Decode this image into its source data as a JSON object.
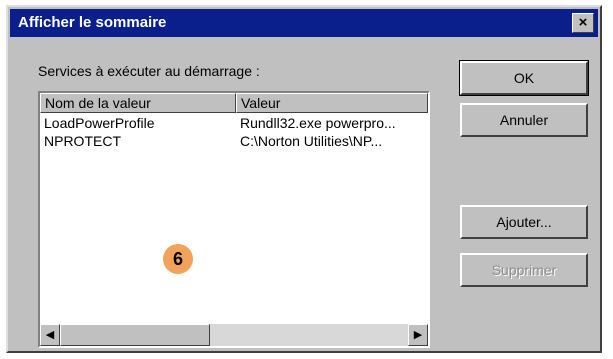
{
  "window": {
    "title": "Afficher le sommaire",
    "close_glyph": "×"
  },
  "label": "Services à exécuter au démarrage :",
  "list": {
    "columns": [
      "Nom de la valeur",
      "Valeur"
    ],
    "rows": [
      {
        "name": "LoadPowerProfile",
        "value": "Rundll32.exe powerpro..."
      },
      {
        "name": "NPROTECT",
        "value": "C:\\Norton Utilities\\NP..."
      }
    ]
  },
  "scrollbar": {
    "left_arrow": "◀",
    "right_arrow": "▶"
  },
  "buttons": {
    "ok": "OK",
    "cancel": "Annuler",
    "add": "Ajouter...",
    "remove": "Supprimer"
  },
  "badge": "6",
  "colors": {
    "titlebar": "#0a1e8c",
    "face": "#c0c0c0",
    "badge": "#f2a35a"
  }
}
